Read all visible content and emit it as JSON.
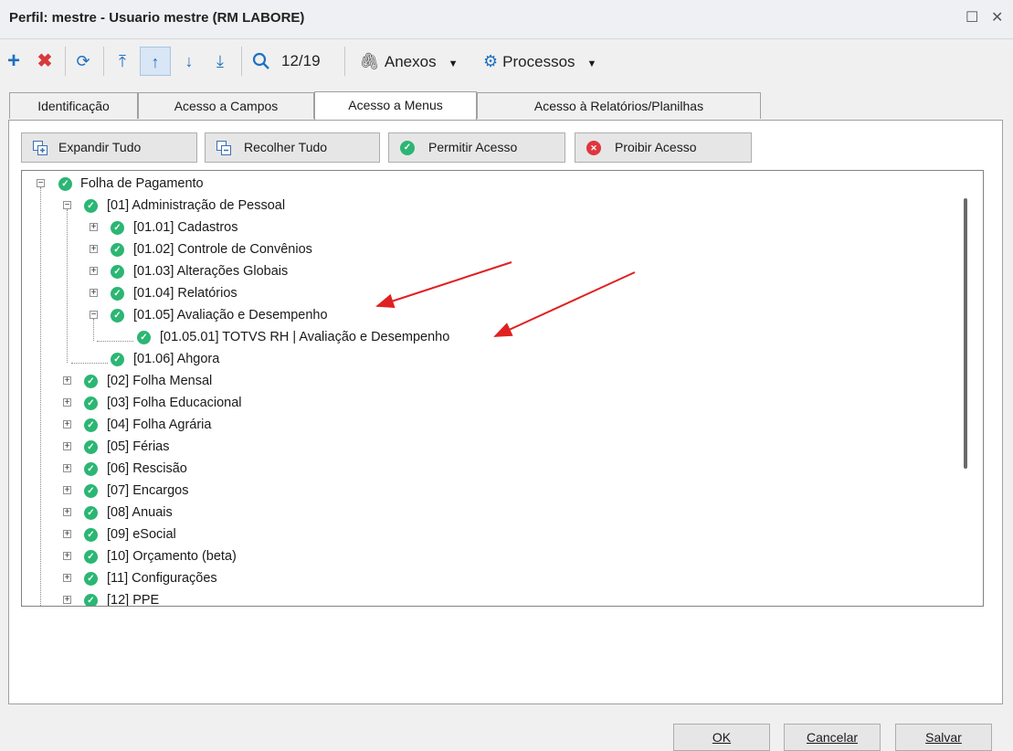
{
  "window": {
    "title": "Perfil: mestre - Usuario mestre (RM LABORE)",
    "maximize_glyph": "☐",
    "close_glyph": "✕"
  },
  "toolbar": {
    "record_counter": "12/19",
    "attachments_label": "Anexos",
    "processes_label": "Processos",
    "icons": [
      "add-icon",
      "delete-icon",
      "refresh-icon",
      "first-record-icon",
      "previous-record-icon",
      "next-record-icon",
      "last-record-icon",
      "search-icon",
      "paperclip-icon",
      "gear-icon"
    ]
  },
  "tabs": [
    {
      "label": "Identificação"
    },
    {
      "label": "Acesso a Campos"
    },
    {
      "label": "Acesso a Menus",
      "active": true
    },
    {
      "label": "Acesso à Relatórios/Planilhas"
    }
  ],
  "actions": {
    "expand_all": "Expandir Tudo",
    "collapse_all": "Recolher Tudo",
    "allow_access": "Permitir Acesso",
    "deny_access": "Proibir Acesso"
  },
  "tree": {
    "root": "Folha de Pagamento",
    "n01": "[01] Administração de Pessoal",
    "n0101": "[01.01] Cadastros",
    "n0102": "[01.02] Controle de Convênios",
    "n0103": "[01.03] Alterações Globais",
    "n0104": "[01.04] Relatórios",
    "n0105": "[01.05] Avaliação e Desempenho",
    "n010501": "[01.05.01] TOTVS RH | Avaliação e Desempenho",
    "n0106": "[01.06] Ahgora",
    "n02": "[02] Folha Mensal",
    "n03": "[03] Folha Educacional",
    "n04": "[04] Folha Agrária",
    "n05": "[05] Férias",
    "n06": "[06] Rescisão",
    "n07": "[07] Encargos",
    "n08": "[08] Anuais",
    "n09": "[09] eSocial",
    "n10": "[10] Orçamento (beta)",
    "n11": "[11] Configurações",
    "n12": "[12] PPE"
  },
  "footer": {
    "ok": "OK",
    "cancel": "Cancelar",
    "save": "Salvar"
  },
  "colors": {
    "allowed": "#2bb673",
    "denied": "#e0353f",
    "annotation_arrow": "#e02020"
  }
}
